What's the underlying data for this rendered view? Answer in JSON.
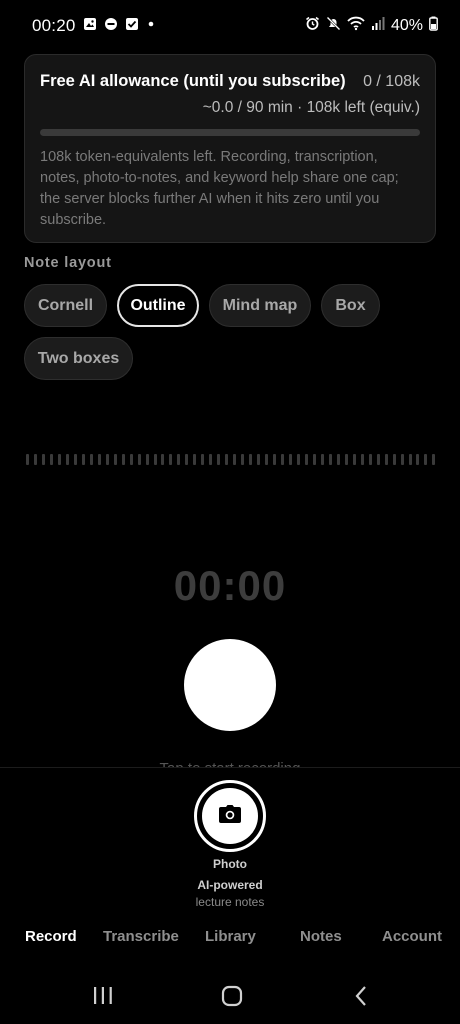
{
  "status_bar": {
    "time": "00:20",
    "left_icons": [
      "gallery-icon",
      "dnd-icon",
      "checkbox-icon",
      "dot-icon"
    ],
    "right_icons": [
      "alarm-icon",
      "mute-icon",
      "wifi-icon",
      "signal-icon"
    ],
    "battery": "40%"
  },
  "allowance": {
    "title": "Free AI allowance (until you subscribe)",
    "count": "0 / 108k",
    "sub": "~0.0 / 90 min · 108k left (equiv.)",
    "progress": 0,
    "description": "108k token-equivalents left. Recording, transcription, notes, photo-to-notes, and keyword help share one cap; the server blocks further AI when it hits zero until you subscribe."
  },
  "note_layout": {
    "title": "Note layout",
    "options": [
      "Cornell",
      "Outline",
      "Mind map",
      "Box",
      "Two boxes"
    ],
    "selected": "Outline"
  },
  "recorder": {
    "timer": "00:00",
    "hint": "Tap to start recording"
  },
  "photo": {
    "label": "Photo",
    "ai_title": "AI-powered",
    "ai_sub": "lecture notes"
  },
  "tabs": [
    "Record",
    "Transcribe",
    "Library",
    "Notes",
    "Account"
  ],
  "active_tab": "Record",
  "colors": {
    "background": "#000000",
    "card": "#151515",
    "accent": "#ffffff"
  }
}
